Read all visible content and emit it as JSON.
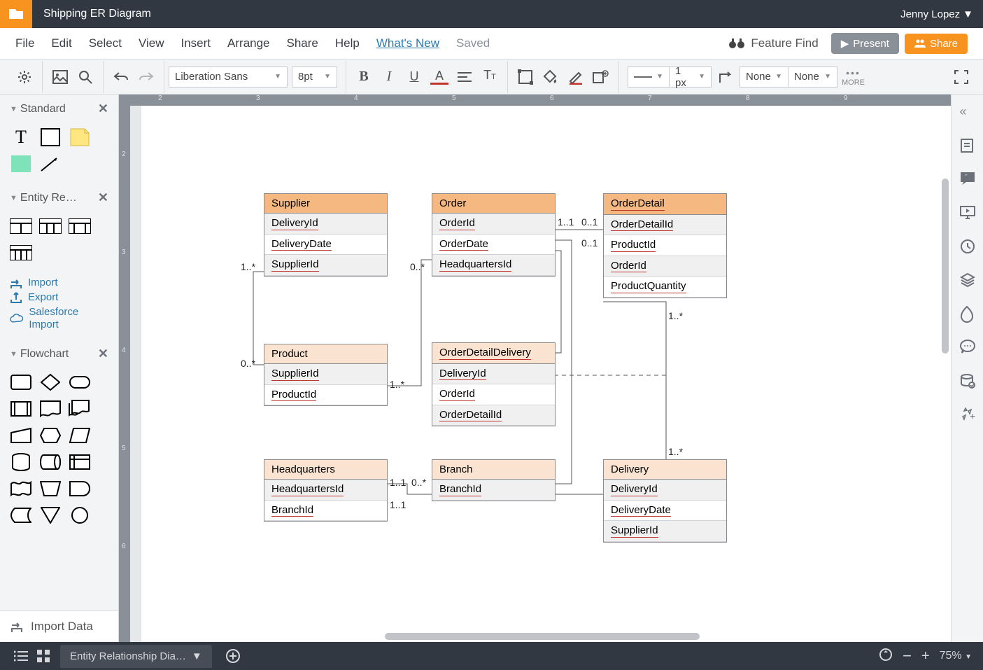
{
  "titlebar": {
    "title": "Shipping ER Diagram",
    "user": "Jenny Lopez"
  },
  "menu": {
    "file": "File",
    "edit": "Edit",
    "select": "Select",
    "view": "View",
    "insert": "Insert",
    "arrange": "Arrange",
    "share": "Share",
    "help": "Help",
    "whatsnew": "What's New",
    "saved": "Saved",
    "featurefind": "Feature Find",
    "present": "Present",
    "sharebtn": "Share"
  },
  "toolbar": {
    "font": "Liberation Sans",
    "fontsize": "8pt",
    "linewidth": "1 px",
    "none1": "None",
    "none2": "None",
    "more": "MORE"
  },
  "sidebar": {
    "standard": "Standard",
    "entity": "Entity Re…",
    "flowchart": "Flowchart",
    "import": "Import",
    "export": "Export",
    "salesforce": "Salesforce Import",
    "importdata": "Import Data"
  },
  "tables": {
    "supplier": {
      "title": "Supplier",
      "rows": [
        "DeliveryId",
        "DeliveryDate",
        "SupplierId"
      ]
    },
    "order": {
      "title": "Order",
      "rows": [
        "OrderId",
        "OrderDate",
        "HeadquartersId"
      ]
    },
    "orderdetail": {
      "title": "OrderDetail",
      "rows": [
        "OrderDetailId",
        "ProductId",
        "OrderId",
        "ProductQuantity"
      ]
    },
    "product": {
      "title": "Product",
      "rows": [
        "SupplierId",
        "ProductId"
      ]
    },
    "orderdetaildelivery": {
      "title": "OrderDetailDelivery",
      "rows": [
        "DeliveryId",
        "OrderId",
        "OrderDetailId"
      ]
    },
    "headquarters": {
      "title": "Headquarters",
      "rows": [
        "HeadquartersId",
        "BranchId"
      ]
    },
    "branch": {
      "title": "Branch",
      "rows": [
        "BranchId"
      ]
    },
    "delivery": {
      "title": "Delivery",
      "rows": [
        "DeliveryId",
        "DeliveryDate",
        "SupplierId"
      ]
    }
  },
  "labels": {
    "l1": "1..*",
    "l2": "0..*",
    "l3": "1..*",
    "l4": "0..*",
    "l5": "1..1",
    "l6": "0..1",
    "l7": "0..1",
    "l8": "1..*",
    "l9": "1..*",
    "l10": "1..1",
    "l11": "1..1",
    "l12": "0..*"
  },
  "bottom": {
    "tab": "Entity Relationship Dia…",
    "zoom": "75%"
  }
}
